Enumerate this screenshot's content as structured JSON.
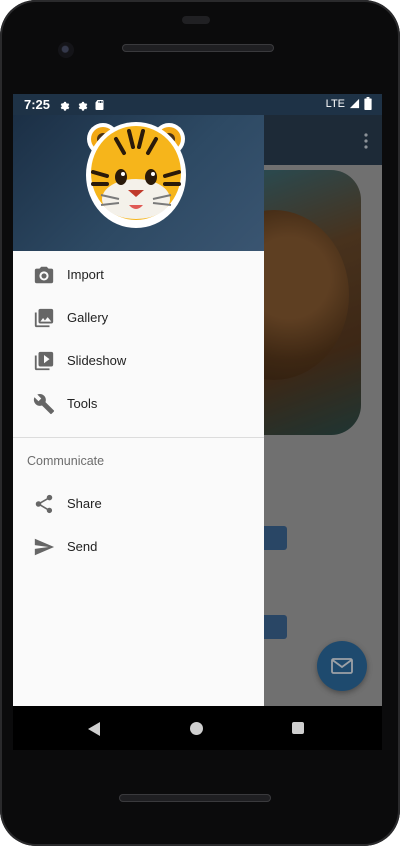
{
  "status_bar": {
    "time": "7:25",
    "network": "LTE",
    "icons": [
      "gear-icon",
      "gear-icon",
      "sd-card-icon",
      "signal-icon",
      "battery-icon"
    ]
  },
  "drawer": {
    "menu_items": [
      {
        "label": "Import",
        "icon": "camera-icon"
      },
      {
        "label": "Gallery",
        "icon": "gallery-icon"
      },
      {
        "label": "Slideshow",
        "icon": "slideshow-icon"
      },
      {
        "label": "Tools",
        "icon": "wrench-icon"
      }
    ],
    "section_title": "Communicate",
    "communicate_items": [
      {
        "label": "Share",
        "icon": "share-icon"
      },
      {
        "label": "Send",
        "icon": "send-icon"
      }
    ],
    "header_avatar": "tiger-emoji-avatar"
  },
  "colors": {
    "status_bar": "#1e3246",
    "drawer_header": "#2d4963",
    "fab": "#2d6ea3"
  }
}
